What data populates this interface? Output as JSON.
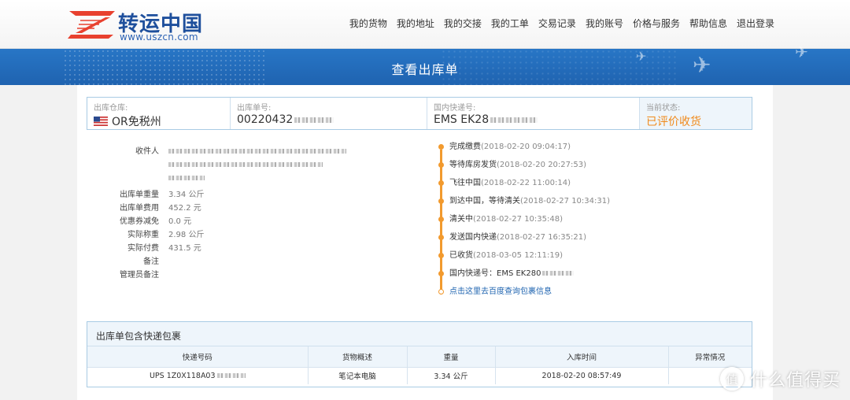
{
  "header": {
    "logo_cn": "转运中国",
    "logo_url": "www.uszcn.com",
    "nav": [
      {
        "label": "我的货物"
      },
      {
        "label": "我的地址"
      },
      {
        "label": "我的交接"
      },
      {
        "label": "我的工单"
      },
      {
        "label": "交易记录"
      },
      {
        "label": "我的账号"
      },
      {
        "label": "价格与服务"
      },
      {
        "label": "帮助信息"
      },
      {
        "label": "退出登录"
      }
    ]
  },
  "banner": {
    "title": "查看出库单"
  },
  "summary": {
    "warehouse_label": "出库仓库:",
    "warehouse_value": "OR免税州",
    "order_label": "出库单号:",
    "order_value": "00220432",
    "express_label": "国内快递号:",
    "express_value": "EMS EK28",
    "status_label": "当前状态:",
    "status_value": "已评价收货"
  },
  "details": {
    "recipient_label": "收件人",
    "weight_label": "出库单重量",
    "weight_value": "3.34 公斤",
    "fee_label": "出库单费用",
    "fee_value": "452.2 元",
    "coupon_label": "优惠券减免",
    "coupon_value": "0.0 元",
    "actual_weight_label": "实际称重",
    "actual_weight_value": "2.98 公斤",
    "actual_paid_label": "实际付费",
    "actual_paid_value": "431.5 元",
    "remark_label": "备注",
    "admin_remark_label": "管理员备注"
  },
  "timeline": [
    {
      "event": "完成缴费",
      "time": "(2018-02-20 09:04:17)"
    },
    {
      "event": "等待库房发货",
      "time": "(2018-02-20 20:27:53)"
    },
    {
      "event": "飞往中国",
      "time": "(2018-02-22 11:00:14)"
    },
    {
      "event": "到达中国，等待清关",
      "time": "(2018-02-27 10:34:31)"
    },
    {
      "event": "清关中",
      "time": "(2018-02-27 10:35:48)"
    },
    {
      "event": "发送国内快递",
      "time": "(2018-02-27 16:35:21)"
    },
    {
      "event": "已收货",
      "time": "(2018-03-05 12:11:19)"
    },
    {
      "event": "国内快递号：EMS EK280",
      "time": ""
    }
  ],
  "timeline_link": "点击这里去百度查询包裹信息",
  "packages": {
    "title": "出库单包含快递包裹",
    "columns": [
      "快递号码",
      "货物概述",
      "重量",
      "入库时间",
      "异常情况"
    ],
    "rows": [
      {
        "tracking": "UPS 1Z0X118A03",
        "desc": "笔记本电脑",
        "weight": "3.34 公斤",
        "time": "2018-02-20 08:57:49",
        "issue": ""
      }
    ]
  },
  "watermark": {
    "icon": "值",
    "text": "什么值得买"
  },
  "colors": {
    "accent": "#f29a2e",
    "brand": "#1f63b0"
  }
}
